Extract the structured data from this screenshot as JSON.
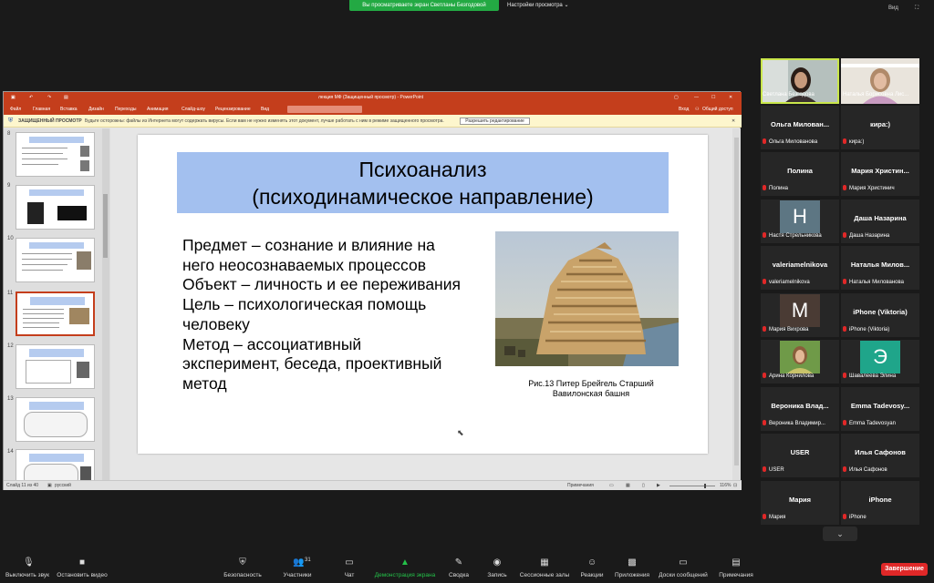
{
  "topbar": {
    "share_banner": "Вы просматриваете экран Светланы Безгодовой",
    "view_options": "Настройки просмотра",
    "view_btn": "Вид"
  },
  "ppt": {
    "window_title": "лекция МФ (Защищенный просмотр) - PowerPoint",
    "tabs": [
      "Файл",
      "Главная",
      "Вставка",
      "Дизайн",
      "Переходы",
      "Анимация",
      "Слайд-шоу",
      "Рецензирование",
      "Вид"
    ],
    "right_items": [
      "Вход",
      "Общий доступ"
    ],
    "warning_label": "ЗАЩИЩЕННЫЙ ПРОСМОТР",
    "warning_text": "Будьте осторожны: файлы из Интернета могут содержать вирусы. Если вам не нужно изменять этот документ, лучше работать с ним в режиме защищенного просмотра.",
    "warning_button": "Разрешить редактирование",
    "thumb_numbers": [
      "8",
      "9",
      "10",
      "11",
      "12",
      "13",
      "14"
    ],
    "status_slide": "Слайд 11 из 40",
    "status_lang": "русский",
    "status_notes": "Примечания",
    "status_zoom": "116%",
    "slide": {
      "title_line1": "Психоанализ",
      "title_line2": "(психодинамическое направление)",
      "body": [
        "Предмет – сознание и влияние на",
        "него неосознаваемых процессов",
        "Объект – личность и ее переживания",
        "Цель – психологическая помощь",
        "человеку",
        "Метод – ассоциативный",
        "эксперимент, беседа, проективный",
        "метод"
      ],
      "caption_line1": "Рис.13 Питер Брейгель Старший",
      "caption_line2": "Вавилонская башня"
    }
  },
  "participants": [
    {
      "big": "",
      "label": "Светлана Безгодова",
      "muted": false,
      "video": "woman-dark"
    },
    {
      "big": "",
      "label": "Наталья Борисовна Лис...",
      "muted": false,
      "video": "woman-light"
    },
    {
      "big": "Ольга   Милован...",
      "label": "Ольга Миловановa",
      "muted": true
    },
    {
      "big": "кира:)",
      "label": "кира:)",
      "muted": true
    },
    {
      "big": "Полина",
      "label": "Полина",
      "muted": true
    },
    {
      "big": "Мария   Христин...",
      "label": "Мария Христинич",
      "muted": true
    },
    {
      "big": "",
      "label": "Настя Стрельникова",
      "muted": true,
      "avatar": "Н",
      "avatar_color": "#5d7683"
    },
    {
      "big": "Даша Назарина",
      "label": "Даша Назарина",
      "muted": true
    },
    {
      "big": "valeriamelnikova",
      "label": "valeriamelnikova",
      "muted": true
    },
    {
      "big": "Наталья   Милов...",
      "label": "Наталья Милованова",
      "muted": true
    },
    {
      "big": "",
      "label": "Мария Вихрова",
      "muted": true,
      "avatar": "M",
      "avatar_color": "#4a3b34"
    },
    {
      "big": "iPhone (Viktoria)",
      "label": "iPhone (Viktoria)",
      "muted": true
    },
    {
      "big": "",
      "label": "Арина Корнилова",
      "muted": true,
      "video": "photo-green"
    },
    {
      "big": "",
      "label": "Шавалеева Элина",
      "muted": true,
      "avatar": "Э",
      "avatar_color": "#1fa58a"
    },
    {
      "big": "Вероника   Влад...",
      "label": "Вероника Владимир...",
      "muted": true
    },
    {
      "big": "Emma   Tadevosy...",
      "label": "Emma Tadevosyan",
      "muted": true
    },
    {
      "big": "USER",
      "label": "USER",
      "muted": true
    },
    {
      "big": "Илья Сафонов",
      "label": "Илья Сафонов",
      "muted": true
    },
    {
      "big": "Мария",
      "label": "Мария",
      "muted": true
    },
    {
      "big": "iPhone",
      "label": "iPhone",
      "muted": true
    }
  ],
  "toolbar": {
    "items": [
      {
        "key": "mute",
        "label": "Выключить звук",
        "icon": "microphone-icon"
      },
      {
        "key": "video",
        "label": "Остановить видео",
        "icon": "video-camera-icon"
      },
      {
        "key": "security",
        "label": "Безопасность",
        "icon": "shield-icon"
      },
      {
        "key": "participants",
        "label": "Участники",
        "icon": "people-icon",
        "count": "31"
      },
      {
        "key": "chat",
        "label": "Чат",
        "icon": "chat-icon"
      },
      {
        "key": "share",
        "label": "Демонстрация экрана",
        "icon": "share-screen-icon"
      },
      {
        "key": "summary",
        "label": "Сводка",
        "icon": "summary-icon"
      },
      {
        "key": "record",
        "label": "Запись",
        "icon": "record-icon"
      },
      {
        "key": "rooms",
        "label": "Сессионные залы",
        "icon": "rooms-icon"
      },
      {
        "key": "reactions",
        "label": "Реакции",
        "icon": "reaction-icon"
      },
      {
        "key": "apps",
        "label": "Приложения",
        "icon": "apps-icon"
      },
      {
        "key": "whiteboard",
        "label": "Доски сообщений",
        "icon": "whiteboard-icon"
      },
      {
        "key": "notes",
        "label": "Примечания",
        "icon": "notes-icon"
      }
    ],
    "end_label": "Завершение"
  },
  "colors": {
    "ppt_red": "#c43e1c",
    "zoom_green": "#23a943",
    "title_blue": "#a3c0ef",
    "end_red": "#e02828",
    "active_speaker": "#c9e64b"
  }
}
